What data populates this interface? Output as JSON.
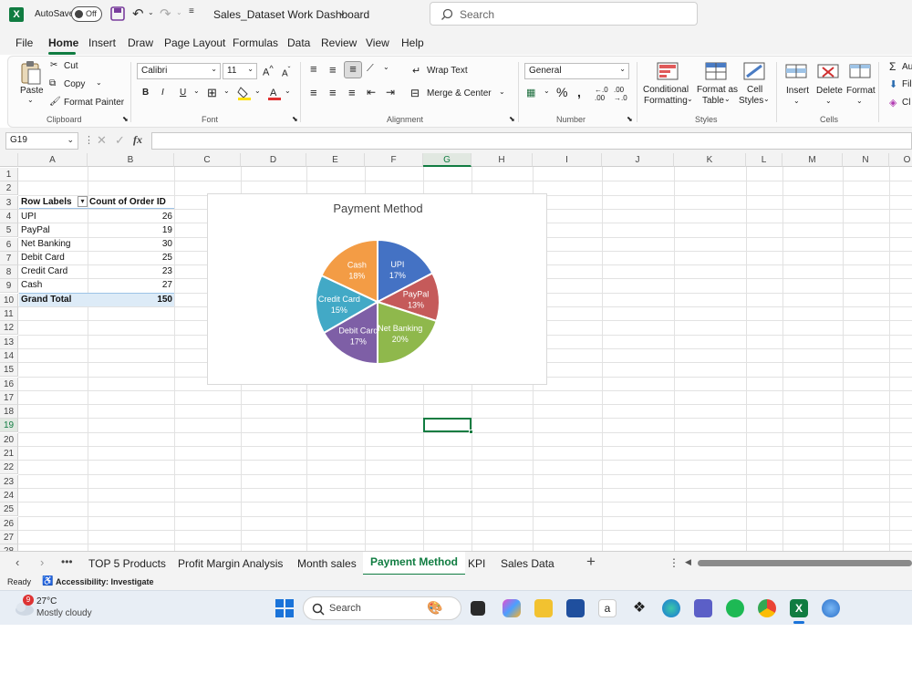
{
  "titlebar": {
    "autosave_label": "AutoSave",
    "toggle_state": "Off",
    "file_title": "Sales_Dataset  Work Dashboard",
    "search_placeholder": "Search"
  },
  "menu": [
    "File",
    "Home",
    "Insert",
    "Draw",
    "Page Layout",
    "Formulas",
    "Data",
    "Review",
    "View",
    "Help"
  ],
  "ribbon": {
    "clipboard": {
      "paste": "Paste",
      "cut": "Cut",
      "copy": "Copy",
      "format_painter": "Format Painter",
      "group": "Clipboard"
    },
    "font": {
      "family": "Calibri",
      "size": "11",
      "group": "Font",
      "bold": "B",
      "italic": "I",
      "underline": "U"
    },
    "alignment": {
      "wrap_text": "Wrap Text",
      "merge_center": "Merge & Center",
      "group": "Alignment"
    },
    "number": {
      "format": "General",
      "group": "Number"
    },
    "styles": {
      "conditional_1": "Conditional",
      "conditional_2": "Formatting",
      "format_as_1": "Format as",
      "format_as_2": "Table",
      "cell_styles_1": "Cell",
      "cell_styles_2": "Styles",
      "group": "Styles"
    },
    "cells": {
      "insert": "Insert",
      "delete": "Delete",
      "format": "Format",
      "group": "Cells"
    },
    "editing": {
      "autosum": "Au",
      "fill": "Fil",
      "clear": "Cl"
    }
  },
  "formula": {
    "namebox": "G19",
    "fx": "fx"
  },
  "columns": [
    "A",
    "B",
    "C",
    "D",
    "E",
    "F",
    "G",
    "H",
    "I",
    "J",
    "K",
    "L",
    "M",
    "N",
    "O"
  ],
  "rows": [
    "1",
    "2",
    "3",
    "4",
    "5",
    "6",
    "7",
    "8",
    "9",
    "10",
    "11",
    "12",
    "13",
    "14",
    "15",
    "16",
    "17",
    "18",
    "19",
    "20",
    "21",
    "22",
    "23",
    "24",
    "25",
    "26",
    "27",
    "28"
  ],
  "pivot": {
    "header_label": "Row Labels",
    "header_count": "Count of Order ID",
    "rows": [
      {
        "label": "UPI",
        "count": "26"
      },
      {
        "label": "PayPal",
        "count": "19"
      },
      {
        "label": "Net Banking",
        "count": "30"
      },
      {
        "label": "Debit Card",
        "count": "25"
      },
      {
        "label": "Credit Card",
        "count": "23"
      },
      {
        "label": "Cash",
        "count": "27"
      }
    ],
    "total_label": "Grand Total",
    "total_count": "150"
  },
  "chart_data": {
    "type": "pie",
    "title": "Payment Method",
    "categories": [
      "UPI",
      "PayPal",
      "Net Banking",
      "Debit Card",
      "Credit Card",
      "Cash"
    ],
    "values": [
      26,
      19,
      30,
      25,
      23,
      27
    ],
    "labels": [
      "17%",
      "13%",
      "20%",
      "17%",
      "15%",
      "18%"
    ],
    "colors": [
      "#4472c4",
      "#c55a5a",
      "#8fb84c",
      "#7e5fa6",
      "#42a9c6",
      "#f39c45"
    ],
    "legend": "none"
  },
  "sheet_tabs": [
    "TOP 5 Products",
    "Profit Margin Analysis",
    "Month sales",
    "Payment Method",
    "KPI",
    "Sales Data"
  ],
  "active_tab": "Payment Method",
  "status": {
    "ready": "Ready",
    "accessibility": "Accessibility: Investigate"
  },
  "taskbar": {
    "temp": "27°C",
    "weather": "Mostly cloudy",
    "search": "Search",
    "badge": "9"
  }
}
